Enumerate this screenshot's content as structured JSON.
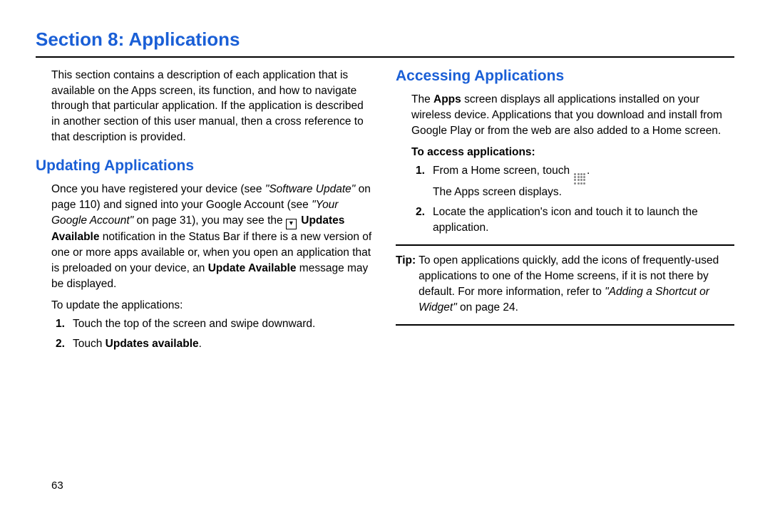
{
  "section_title": "Section 8: Applications",
  "page_number": "63",
  "left": {
    "intro": "This section contains a description of each application that is available on the Apps screen, its function, and how to navigate through that particular application. If the application is described in another section of this user manual, then a cross reference to that description is provided.",
    "updating_heading": "Updating Applications",
    "updating_p1_a": "Once you have registered your device (see ",
    "updating_xref1": "\"Software Update\"",
    "updating_p1_b": " on page 110) and signed into your Google Account (see ",
    "updating_xref2": "\"Your Google Account\"",
    "updating_p1_c": " on page 31), you may see the ",
    "updating_bold1": "Updates Available",
    "updating_p1_d": " notification in the Status Bar if there is a new version of one or more apps available or, when you open an application that is preloaded on your device, an ",
    "updating_bold2": "Update Available",
    "updating_p1_e": " message may be displayed.",
    "to_update_label": "To update the applications:",
    "step1_num": "1.",
    "step1_text": "Touch the top of the screen and swipe downward.",
    "step2_num": "2.",
    "step2_a": "Touch ",
    "step2_bold": "Updates available",
    "step2_b": "."
  },
  "right": {
    "accessing_heading": "Accessing Applications",
    "accessing_p1_a": "The ",
    "accessing_bold1": "Apps",
    "accessing_p1_b": " screen displays all applications installed on your wireless device. Applications that you download and install from Google Play or from the web are also added to a Home screen.",
    "to_access_label": "To access applications:",
    "step1_num": "1.",
    "step1_a": "From a Home screen, touch ",
    "step1_b": ".",
    "step1_line2": "The Apps screen displays.",
    "step2_num": "2.",
    "step2_text": "Locate the application's icon and touch it to launch the application.",
    "tip_label": "Tip:",
    "tip_a": "To open applications quickly, add the icons of frequently-used applications to one of the Home screens, if it is not there by default. For more information, refer to ",
    "tip_xref": "\"Adding a Shortcut or Widget\"",
    "tip_b": " on page 24."
  }
}
